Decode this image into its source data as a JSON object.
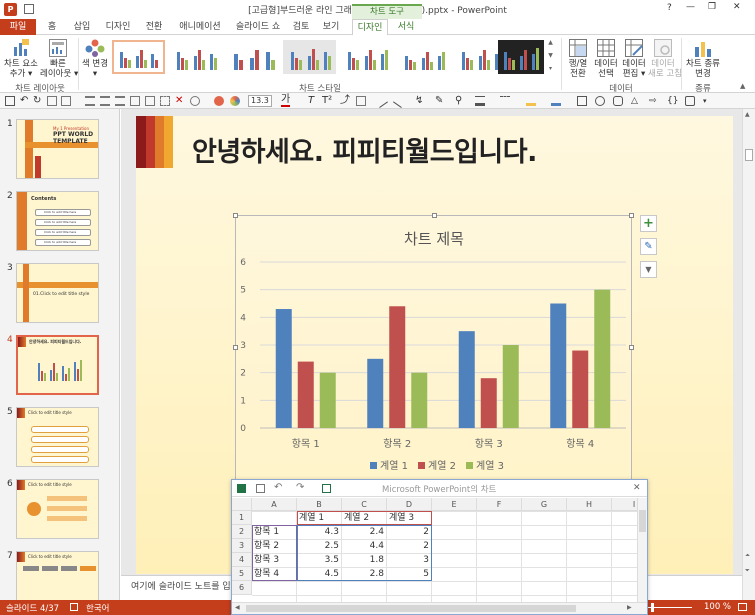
{
  "window": {
    "title": "[고급형]부드러운 라인 그래픽(자동완성형포함).pptx - PowerPoint",
    "context_tab_group": "차트 도구",
    "controls": {
      "help": "?",
      "minimize": "—",
      "restore": "❐",
      "close": "✕"
    }
  },
  "tabs": [
    {
      "label": "파일"
    },
    {
      "label": "홈"
    },
    {
      "label": "삽입"
    },
    {
      "label": "디자인"
    },
    {
      "label": "전환"
    },
    {
      "label": "애니메이션"
    },
    {
      "label": "슬라이드 쇼"
    },
    {
      "label": "검토"
    },
    {
      "label": "보기"
    },
    {
      "label": "디자인"
    },
    {
      "label": "서식"
    }
  ],
  "ribbon": {
    "add_element": "차트 요소\n추가 ▾",
    "quick_layout": "빠른\n레이아웃 ▾",
    "change_color": "색 변경\n▾",
    "group_layout": "차트 레이아웃",
    "group_styles": "차트 스타일",
    "switch_row_col": "행/열\n전환",
    "select_data": "데이터\n선택",
    "edit_data": "데이터\n편집 ▾",
    "refresh_data": "데이터\n새로 고침",
    "group_data": "데이터",
    "change_type": "차트 종류\n변경",
    "group_type": "종류"
  },
  "qat": {
    "font_size": "13.3",
    "font_color_glyph": "가"
  },
  "thumbnails": [
    {
      "num": "1",
      "title": "PPT WORLD TEMPLATE",
      "kicker": "My 1 Presentation"
    },
    {
      "num": "2",
      "title": "Contents",
      "items": [
        "Click to add title here",
        "Click to add title here",
        "Click to add title here",
        "Click to add title here"
      ]
    },
    {
      "num": "3",
      "title": "01.Click to edit title style"
    },
    {
      "num": "4",
      "title": "안녕하세요. 피피티월드입니다."
    },
    {
      "num": "5",
      "title": "Click to edit title style"
    },
    {
      "num": "6",
      "title": "Click to edit title style"
    },
    {
      "num": "7",
      "title": "Click to edit title style"
    }
  ],
  "slide": {
    "title": "안녕하세요. 피피티월드입니다."
  },
  "chart_data": {
    "type": "bar",
    "title": "차트 제목",
    "categories": [
      "항목 1",
      "항목 2",
      "항목 3",
      "항목 4"
    ],
    "series": [
      {
        "name": "계열 1",
        "values": [
          4.3,
          2.5,
          3.5,
          4.5
        ],
        "color": "#4f81bd"
      },
      {
        "name": "계열 2",
        "values": [
          2.4,
          4.4,
          1.8,
          2.8
        ],
        "color": "#c0504d"
      },
      {
        "name": "계열 3",
        "values": [
          2,
          2,
          3,
          5
        ],
        "color": "#9bbb59"
      }
    ],
    "ylim": [
      0,
      6
    ],
    "yticks": [
      "0",
      "1",
      "2",
      "3",
      "4",
      "5",
      "6"
    ],
    "grid": true,
    "legend": "bottom"
  },
  "chart_tools": {
    "add": "+",
    "brush": "✎",
    "filter": "▼"
  },
  "notes": {
    "placeholder": "여기에 슬라이드 노트를 입력하세요."
  },
  "status": {
    "slide": "슬라이드 4/37",
    "language": "한국어",
    "zoom": "100 %"
  },
  "datasheet": {
    "title": "Microsoft PowerPoint의 차트",
    "close": "✕",
    "col_headers": [
      "A",
      "B",
      "C",
      "D",
      "E",
      "F",
      "G",
      "H",
      "I"
    ],
    "row_headers": [
      "1",
      "2",
      "3",
      "4",
      "5",
      "6"
    ],
    "header_row": [
      "",
      "계열 1",
      "계열 2",
      "계열 3"
    ],
    "rows": [
      [
        "항목 1",
        "4.3",
        "2.4",
        "2"
      ],
      [
        "항목 2",
        "2.5",
        "4.4",
        "2"
      ],
      [
        "항목 3",
        "3.5",
        "1.8",
        "3"
      ],
      [
        "항목 4",
        "4.5",
        "2.8",
        "5"
      ]
    ]
  }
}
